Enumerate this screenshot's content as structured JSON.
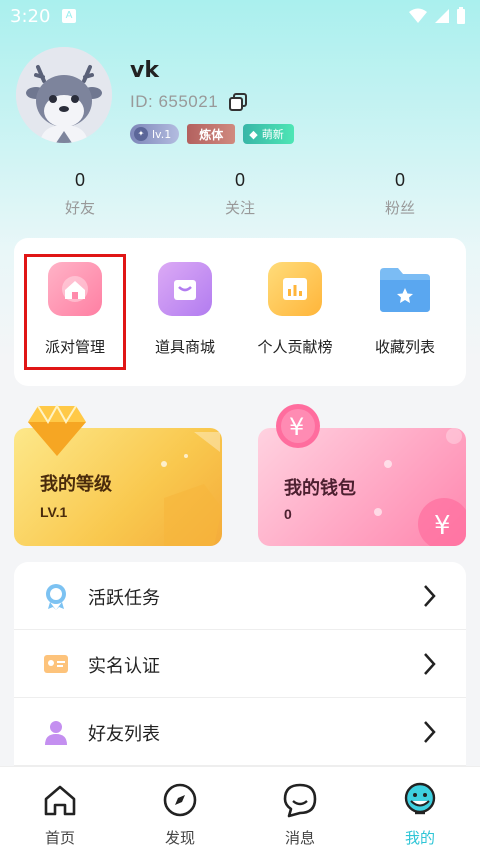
{
  "status_bar": {
    "time": "3:20"
  },
  "profile": {
    "username": "vk",
    "user_id": "ID: 655021",
    "badges": {
      "level": "lv.1",
      "role": "炼体",
      "green": "萌新"
    }
  },
  "stats": [
    {
      "value": "0",
      "label": "好友"
    },
    {
      "value": "0",
      "label": "关注"
    },
    {
      "value": "0",
      "label": "粉丝"
    }
  ],
  "menu": [
    {
      "label": "派对管理",
      "icon": "home-icon"
    },
    {
      "label": "道具商城",
      "icon": "shop-bag-icon"
    },
    {
      "label": "个人贡献榜",
      "icon": "bar-chart-icon"
    },
    {
      "label": "收藏列表",
      "icon": "star-folder-icon"
    }
  ],
  "level_card": {
    "title": "我的等级",
    "value": "LV.1"
  },
  "wallet_card": {
    "title": "我的钱包",
    "value": "0"
  },
  "list": [
    {
      "label": "活跃任务",
      "icon": "medal-icon"
    },
    {
      "label": "实名认证",
      "icon": "id-card-icon"
    },
    {
      "label": "好友列表",
      "icon": "user-icon"
    }
  ],
  "nav": [
    {
      "label": "首页",
      "icon": "home-outline-icon"
    },
    {
      "label": "发现",
      "icon": "compass-icon"
    },
    {
      "label": "消息",
      "icon": "chat-bubble-icon"
    },
    {
      "label": "我的",
      "icon": "profile-face-icon",
      "active": true
    }
  ],
  "colors": {
    "accent": "#2ec5d6",
    "highlight": "#e01616"
  }
}
